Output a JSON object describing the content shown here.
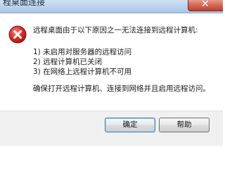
{
  "window": {
    "title": "程桌面连接"
  },
  "message": {
    "headline": "远程桌面由于以下原因之一无法连接到远程计算机:",
    "reasons": [
      "1) 未启用对服务器的远程访问",
      "2) 远程计算机已关闭",
      "3) 在网络上远程计算机不可用"
    ],
    "advice": "确保打开远程计算机、连接到网络并且启用远程访问。"
  },
  "buttons": {
    "ok_label": "确定",
    "help_label": "帮助"
  },
  "icons": {
    "error": "error-icon",
    "close": "close-icon"
  },
  "colors": {
    "error_red": "#d5312c",
    "close_button": "#c0412e",
    "titlebar": "#b9d1ec",
    "footer": "#f0f0f0"
  }
}
